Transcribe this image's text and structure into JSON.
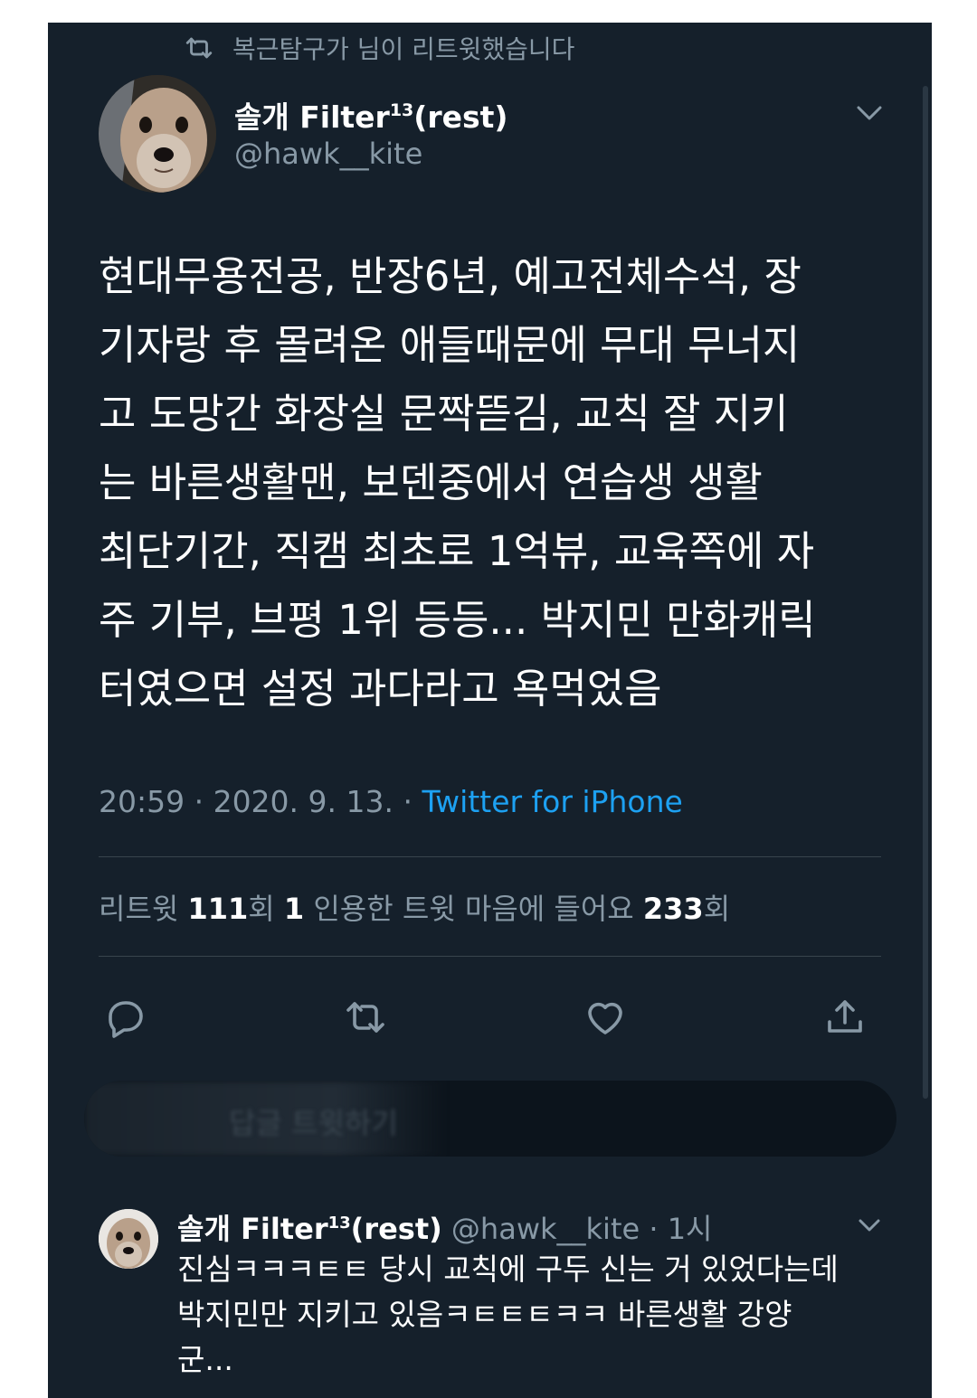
{
  "retweet_banner": {
    "icon": "retweet-icon",
    "text": "복근탐구가 님이 리트윗했습니다"
  },
  "tweet": {
    "display_name": "솔개 Filter",
    "name_superscript": "13",
    "name_suffix": "(rest)",
    "handle": "@hawk__kite",
    "text": "현대무용전공, 반장6년, 예고전체수석, 장\n기자랑 후 몰려온 애들때문에 무대 무너지\n고 도망간 화장실 문짝뜯김, 교칙 잘 지키\n는 바른생활맨, 보덴중에서 연습생 생활\n최단기간, 직캠 최초로 1억뷰, 교육쪽에 자\n주 기부, 브평 1위 등등... 박지민 만화캐릭\n터였으면 설정 과다라고 욕먹었음",
    "timestamp": "20:59 · 2020. 9. 13. · ",
    "source": "Twitter for iPhone"
  },
  "stats": {
    "retweet_label": "리트윗 ",
    "retweet_count": "111",
    "retweet_unit": "회  ",
    "quote_count": "1",
    "quote_label": " 인용한 트윗  ",
    "like_label": "마음에 들어요 ",
    "like_count": "233",
    "like_unit": "회"
  },
  "actions": {
    "reply_icon": "reply-icon",
    "retweet_icon": "retweet-icon",
    "like_icon": "heart-icon",
    "share_icon": "share-icon"
  },
  "reply_bar": {
    "placeholder": "답글 트윗하기"
  },
  "reply": {
    "display_name": "솔개 Filter",
    "name_superscript": "13",
    "name_suffix": "(rest)",
    "meta": " @hawk__kite · 1시",
    "text": "진심ㅋㅋㅋㅌㅌ 당시 교칙에 구두 신는 거 있었다는데\n박지민만 지키고 있음ㅋㅌㅌㅌㅋㅋ 바른생활 강양\n군..."
  },
  "colors": {
    "background": "#15202b",
    "text_primary": "#ffffff",
    "text_secondary": "#8899a6",
    "accent": "#1da1f2",
    "divider": "#38444d"
  }
}
